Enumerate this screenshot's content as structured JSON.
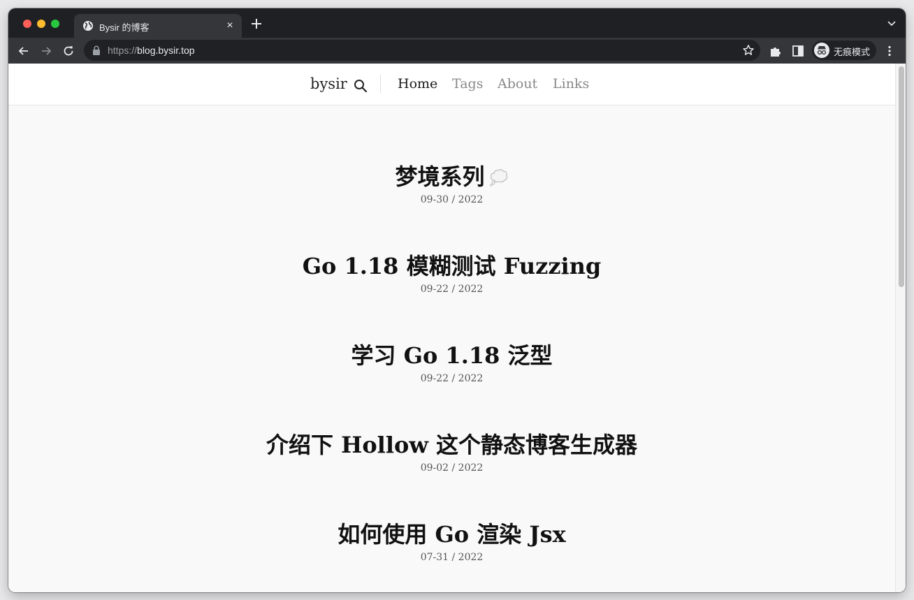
{
  "browser": {
    "tab": {
      "title": "Bysir 的博客",
      "close_glyph": "×",
      "favicon": "globe-icon"
    },
    "address": {
      "scheme": "https://",
      "host": "blog.bysir.top"
    },
    "profile": {
      "label": "无痕模式",
      "icon": "incognito-icon"
    }
  },
  "site": {
    "brand": "bysir",
    "nav": [
      {
        "label": "Home",
        "active": true
      },
      {
        "label": "Tags",
        "active": false
      },
      {
        "label": "About",
        "active": false
      },
      {
        "label": "Links",
        "active": false
      }
    ]
  },
  "posts": [
    {
      "title": "梦境系列",
      "date": "09-30 / 2022",
      "icon": "thought-bubble-icon"
    },
    {
      "title": "Go 1.18 模糊测试 Fuzzing",
      "date": "09-22 / 2022"
    },
    {
      "title": "学习 Go 1.18 泛型",
      "date": "09-22 / 2022"
    },
    {
      "title": "介绍下 Hollow 这个静态博客生成器",
      "date": "09-02 / 2022"
    },
    {
      "title": "如何使用 Go 渲染 Jsx",
      "date": "07-31 / 2022"
    }
  ],
  "colors": {
    "chrome_dark": "#1f2023",
    "toolbar": "#35363a",
    "page_bg": "#f9f9f9"
  }
}
